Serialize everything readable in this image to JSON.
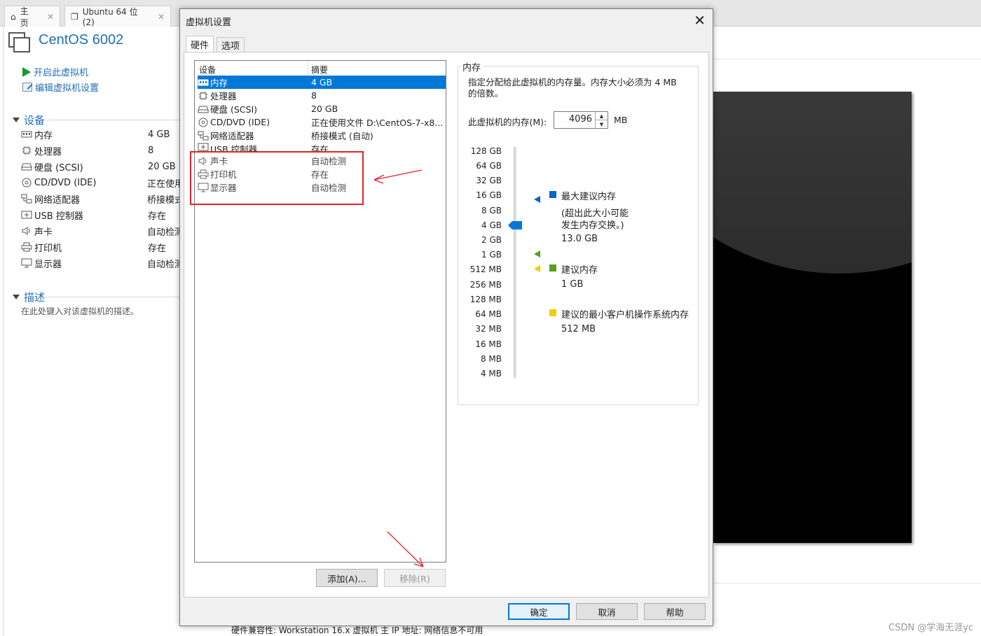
{
  "colors": {
    "accent": "#1f6fb7",
    "selection": "#0078d7",
    "highlight_box": "#e0242b",
    "max_marker": "#0a64c8",
    "recommended_marker": "#5a9e1a",
    "min_marker": "#f0d000"
  },
  "tabs": [
    {
      "label": "主页",
      "icon": "home-icon"
    },
    {
      "label": "Ubuntu 64 位 (2)",
      "icon": "vm-tab-icon"
    }
  ],
  "vm": {
    "title": "CentOS 6002",
    "actions": {
      "power_on": "开启此虚拟机",
      "edit_settings": "编辑虚拟机设置"
    },
    "devices_section": "设备",
    "devices": [
      {
        "name": "内存",
        "value": "4 GB",
        "icon": "memory-icon"
      },
      {
        "name": "处理器",
        "value": "8",
        "icon": "cpu-icon"
      },
      {
        "name": "硬盘 (SCSI)",
        "value": "20 GB",
        "icon": "harddisk-icon"
      },
      {
        "name": "CD/DVD (IDE)",
        "value": "正在使用",
        "icon": "cdrom-icon"
      },
      {
        "name": "网络适配器",
        "value": "桥接模式",
        "icon": "network-icon"
      },
      {
        "name": "USB 控制器",
        "value": "存在",
        "icon": "usb-icon"
      },
      {
        "name": "声卡",
        "value": "自动检测",
        "icon": "sound-icon"
      },
      {
        "name": "打印机",
        "value": "存在",
        "icon": "printer-icon"
      },
      {
        "name": "显示器",
        "value": "自动检测",
        "icon": "display-icon"
      }
    ],
    "description_section": "描述",
    "description_placeholder": "在此处键入对该虚拟机的描述。"
  },
  "bottom_text": "硬件兼容性: Workstation 16.x 虚拟机    主 IP 地址: 网络信息不可用",
  "watermark": "CSDN @学海无涯yc",
  "dialog": {
    "title": "虚拟机设置",
    "close": "✕",
    "tabs": [
      "硬件",
      "选项"
    ],
    "list_header": {
      "device": "设备",
      "summary": "摘要"
    },
    "devices": [
      {
        "name": "内存",
        "value": "4 GB",
        "icon": "memory-icon",
        "selected": true
      },
      {
        "name": "处理器",
        "value": "8",
        "icon": "cpu-icon"
      },
      {
        "name": "硬盘 (SCSI)",
        "value": "20 GB",
        "icon": "harddisk-icon"
      },
      {
        "name": "CD/DVD (IDE)",
        "value": "正在使用文件 D:\\CentOS-7-x8...",
        "icon": "cdrom-icon"
      },
      {
        "name": "网络适配器",
        "value": "桥接模式 (自动)",
        "icon": "network-icon"
      },
      {
        "name": "USB 控制器",
        "value": "存在",
        "icon": "usb-icon"
      },
      {
        "name": "声卡",
        "value": "自动检测",
        "icon": "sound-icon"
      },
      {
        "name": "打印机",
        "value": "存在",
        "icon": "printer-icon"
      },
      {
        "name": "显示器",
        "value": "自动检测",
        "icon": "display-icon"
      }
    ],
    "add_button": "添加(A)...",
    "remove_button": "移除(R)",
    "memory": {
      "group_title": "内存",
      "description": "指定分配给此虚拟机的内存量。内存大小必须为 4 MB 的倍数。",
      "label": "此虚拟机的内存(M):",
      "value": "4096",
      "unit": "MB",
      "scale": [
        "128 GB",
        "64 GB",
        "32 GB",
        "16 GB",
        "8 GB",
        "4 GB",
        "2 GB",
        "1 GB",
        "512 MB",
        "256 MB",
        "128 MB",
        "64 MB",
        "32 MB",
        "16 MB",
        "8 MB",
        "4 MB"
      ],
      "slider_value": "4 GB",
      "legend": {
        "max_title": "最大建议内存",
        "max_note_1": "(超出此大小可能",
        "max_note_2": "发生内存交换。)",
        "max_value": "13.0 GB",
        "rec_title": "建议内存",
        "rec_value": "1 GB",
        "min_title": "建议的最小客户机操作系统内存",
        "min_value": "512 MB"
      }
    },
    "ok": "确定",
    "cancel": "取消",
    "help": "帮助"
  }
}
